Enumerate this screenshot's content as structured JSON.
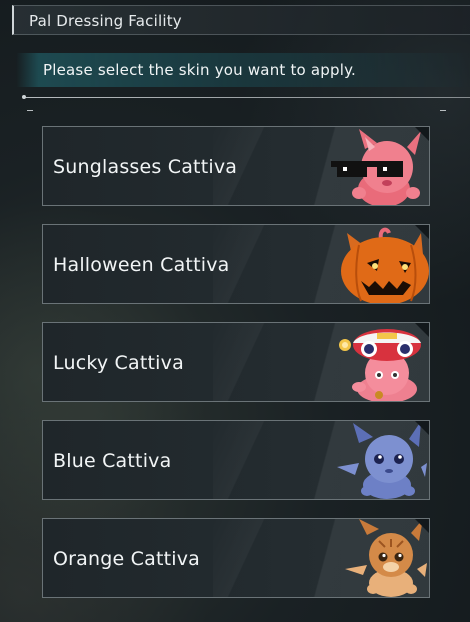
{
  "window": {
    "title": "Pal Dressing Facility"
  },
  "prompt": {
    "text": "Please select the skin you want to apply."
  },
  "skins": [
    {
      "label": "Sunglasses Cattiva",
      "icon": "sunglasses-cattiva-icon"
    },
    {
      "label": "Halloween Cattiva",
      "icon": "halloween-cattiva-icon"
    },
    {
      "label": "Lucky Cattiva",
      "icon": "lucky-cattiva-icon"
    },
    {
      "label": "Blue Cattiva",
      "icon": "blue-cattiva-icon"
    },
    {
      "label": "Orange Cattiva",
      "icon": "orange-cattiva-icon"
    }
  ],
  "colors": {
    "background": "#1a2124",
    "panel_border": "#6a7377",
    "prompt_glow": "#236e78",
    "text": "#f2f5f6"
  }
}
